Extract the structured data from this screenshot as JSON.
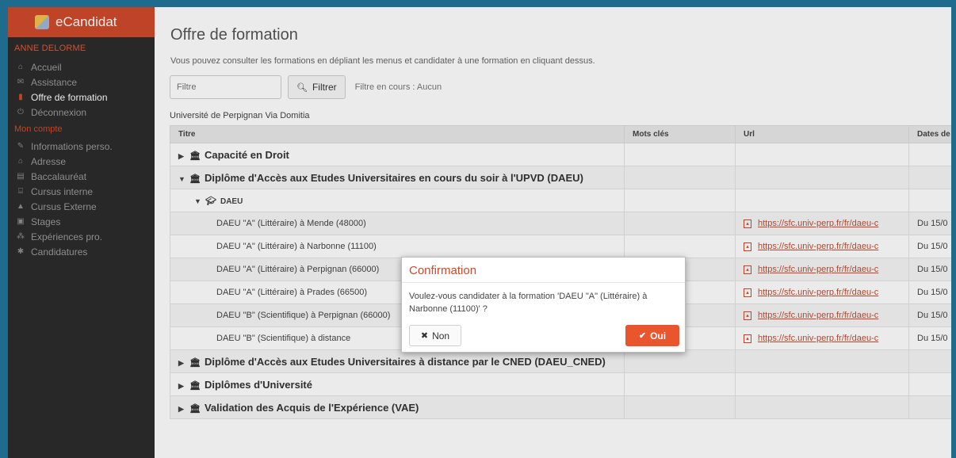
{
  "app": {
    "brand": "eCandidat",
    "user": "ANNE DELORME"
  },
  "sidebar": {
    "items": [
      {
        "label": "Accueil",
        "icon": "home-icon"
      },
      {
        "label": "Assistance",
        "icon": "support-icon"
      },
      {
        "label": "Offre de formation",
        "icon": "bookmark-icon",
        "active": true
      },
      {
        "label": "Déconnexion",
        "icon": "power-icon"
      }
    ],
    "section": "Mon compte",
    "account_items": [
      {
        "label": "Informations perso.",
        "icon": "pencil-icon"
      },
      {
        "label": "Adresse",
        "icon": "home-icon"
      },
      {
        "label": "Baccalauréat",
        "icon": "book-icon"
      },
      {
        "label": "Cursus interne",
        "icon": "bank-icon"
      },
      {
        "label": "Cursus Externe",
        "icon": "graduation-cap-icon"
      },
      {
        "label": "Stages",
        "icon": "briefcase-icon"
      },
      {
        "label": "Expériences pro.",
        "icon": "sitemap-icon"
      },
      {
        "label": "Candidatures",
        "icon": "asterisk-icon"
      }
    ]
  },
  "main": {
    "title": "Offre de formation",
    "intro": "Vous pouvez consulter les formations en dépliant les menus et candidater à une formation en cliquant dessus.",
    "filter_placeholder": "Filtre",
    "filter_button": "Filtrer",
    "filter_status": "Filtre en cours : Aucun",
    "university": "Université de Perpignan Via Domitia",
    "columns": [
      "Titre",
      "Mots clés",
      "Url",
      "Dates de"
    ],
    "rows": [
      {
        "level": 0,
        "caret": "▶",
        "title": "Capacité en Droit",
        "url": "",
        "dates": ""
      },
      {
        "level": 0,
        "caret": "▼",
        "title": "Diplôme d'Accès aux Etudes Universitaires en cours du soir à l'UPVD (DAEU)",
        "url": "",
        "dates": ""
      },
      {
        "level": 1,
        "caret": "▼",
        "title": "DAEU",
        "url": "",
        "dates": ""
      },
      {
        "level": 2,
        "title": "DAEU \"A\" (Littéraire) à Mende (48000)",
        "url": "https://sfc.univ-perp.fr/fr/daeu-c",
        "dates": "Du 15/0"
      },
      {
        "level": 2,
        "title": "DAEU \"A\" (Littéraire) à Narbonne (11100)",
        "url": "https://sfc.univ-perp.fr/fr/daeu-c",
        "dates": "Du 15/0"
      },
      {
        "level": 2,
        "title": "DAEU \"A\" (Littéraire) à Perpignan (66000)",
        "url": "https://sfc.univ-perp.fr/fr/daeu-c",
        "dates": "Du 15/0"
      },
      {
        "level": 2,
        "title": "DAEU \"A\" (Littéraire) à Prades (66500)",
        "url": "https://sfc.univ-perp.fr/fr/daeu-c",
        "dates": "Du 15/0"
      },
      {
        "level": 2,
        "title": "DAEU \"B\" (Scientifique) à Perpignan (66000)",
        "url": "https://sfc.univ-perp.fr/fr/daeu-c",
        "dates": "Du 15/0"
      },
      {
        "level": 2,
        "title": "DAEU \"B\" (Scientifique) à distance",
        "url": "https://sfc.univ-perp.fr/fr/daeu-c",
        "dates": "Du 15/0"
      },
      {
        "level": 0,
        "caret": "▶",
        "title": "Diplôme d'Accès aux Etudes Universitaires à distance par le CNED (DAEU_CNED)",
        "url": "",
        "dates": ""
      },
      {
        "level": 0,
        "caret": "▶",
        "title": "Diplômes d'Université",
        "url": "",
        "dates": ""
      },
      {
        "level": 0,
        "caret": "▶",
        "title": "Validation des Acquis de l'Expérience (VAE)",
        "url": "",
        "dates": ""
      }
    ]
  },
  "dialog": {
    "title": "Confirmation",
    "message": "Voulez-vous candidater à la formation 'DAEU \"A\" (Littéraire) à Narbonne (11100)' ?",
    "cancel": "Non",
    "confirm": "Oui"
  },
  "colors": {
    "accent": "#d0492a",
    "confirm_button": "#e9552d",
    "sidebar_bg": "#2c2c2c",
    "frame_border": "#1f6b8e"
  }
}
